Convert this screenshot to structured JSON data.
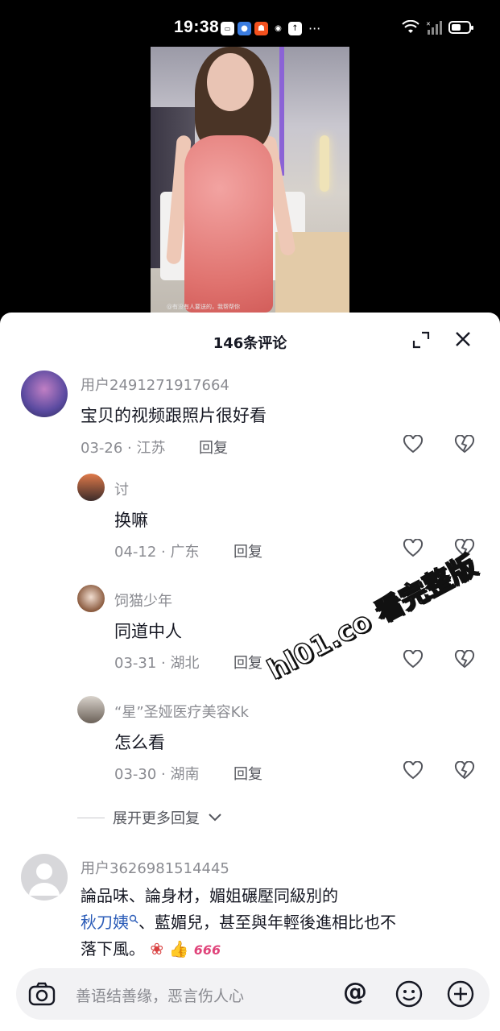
{
  "status_bar": {
    "time": "19:38",
    "more": "···",
    "battery_level": 0.55
  },
  "video": {
    "caption": "@有没有人要送的，我帮帮你"
  },
  "comments_sheet": {
    "title": "146条评论",
    "comments": [
      {
        "user": "用户2491271917664",
        "text": "宝贝的视频跟照片很好看",
        "date": "03-26",
        "location": "江苏",
        "reply_label": "回复"
      }
    ],
    "replies": [
      {
        "user": "讨",
        "text": "换嘛",
        "date": "04-12",
        "location": "广东",
        "reply_label": "回复"
      },
      {
        "user": "饲猫少年",
        "text": "同道中人",
        "date": "03-31",
        "location": "湖北",
        "reply_label": "回复"
      },
      {
        "user": "“星”圣娅医疗美容Kk",
        "text": "怎么看",
        "date": "03-30",
        "location": "湖南",
        "reply_label": "回复"
      }
    ],
    "expand_replies": "展开更多回复",
    "second_comment": {
      "user": "用户3626981514445",
      "text_line1": "論品味、論身材，媚姐碾壓同級別的",
      "tag": "秋刀姨",
      "text_line2_rest": "、藍媚兒，甚至與年輕後進相比也不",
      "text_line3": "落下風。"
    },
    "input_placeholder": "善语结善缘，恶言伤人心",
    "at_symbol": "@"
  },
  "watermark": "hl01.co 看完整版"
}
